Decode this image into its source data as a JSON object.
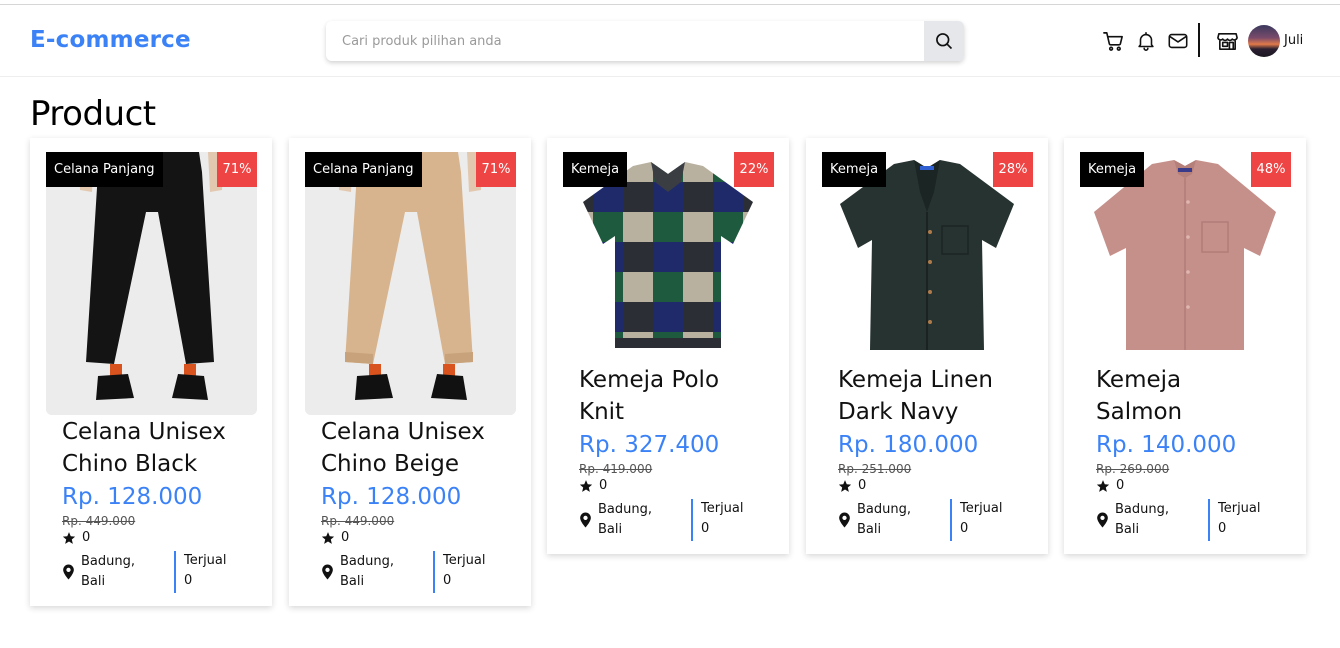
{
  "header": {
    "brand": "E-commerce",
    "search": {
      "placeholder": "Cari produk pilihan anda",
      "value": ""
    },
    "icons": [
      "search-icon",
      "cart-icon",
      "bell-icon",
      "mail-icon",
      "store-icon"
    ],
    "user": {
      "name": "Juli"
    }
  },
  "page": {
    "title": "Product"
  },
  "colors": {
    "brand": "#3b82f6",
    "discount": "#ef4444",
    "category": "#000000"
  },
  "products": [
    {
      "category": "Celana Panjang",
      "discount": "71%",
      "name_lines": [
        "Celana Unisex",
        "Chino Black"
      ],
      "price": "Rp. 128.000",
      "old_price": "Rp. 449.000",
      "rating": "0",
      "location_lines": [
        "Badung,",
        "Bali"
      ],
      "sold_label": "Terjual",
      "sold": "0"
    },
    {
      "category": "Celana Panjang",
      "discount": "71%",
      "name_lines": [
        "Celana Unisex",
        "Chino Beige"
      ],
      "price": "Rp. 128.000",
      "old_price": "Rp. 449.000",
      "rating": "0",
      "location_lines": [
        "Badung,",
        "Bali"
      ],
      "sold_label": "Terjual",
      "sold": "0"
    },
    {
      "category": "Kemeja",
      "discount": "22%",
      "name_lines": [
        "Kemeja Polo",
        "Knit"
      ],
      "price": "Rp. 327.400",
      "old_price": "Rp. 419.000",
      "rating": "0",
      "location_lines": [
        "Badung,",
        "Bali"
      ],
      "sold_label": "Terjual",
      "sold": "0"
    },
    {
      "category": "Kemeja",
      "discount": "28%",
      "name_lines": [
        "Kemeja Linen",
        "Dark Navy"
      ],
      "price": "Rp. 180.000",
      "old_price": "Rp. 251.000",
      "rating": "0",
      "location_lines": [
        "Badung,",
        "Bali"
      ],
      "sold_label": "Terjual",
      "sold": "0"
    },
    {
      "category": "Kemeja",
      "discount": "48%",
      "name_lines": [
        "Kemeja",
        "Salmon"
      ],
      "price": "Rp. 140.000",
      "old_price": "Rp. 269.000",
      "rating": "0",
      "location_lines": [
        "Badung,",
        "Bali"
      ],
      "sold_label": "Terjual",
      "sold": "0"
    }
  ]
}
